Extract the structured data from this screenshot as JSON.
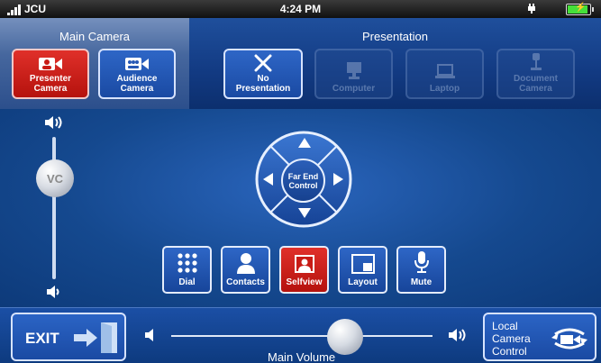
{
  "status_bar": {
    "carrier": "JCU",
    "time": "4:24 PM"
  },
  "camera_section": {
    "title": "Main Camera",
    "buttons": [
      {
        "label_line1": "Presenter",
        "label_line2": "Camera",
        "state": "selected"
      },
      {
        "label_line1": "Audience",
        "label_line2": "Camera",
        "state": "normal"
      }
    ]
  },
  "presentation_section": {
    "title": "Presentation",
    "buttons": [
      {
        "label_line1": "No",
        "label_line2": "Presentation",
        "state": "normal"
      },
      {
        "label_line1": "Computer",
        "label_line2": "",
        "state": "disabled"
      },
      {
        "label_line1": "Laptop",
        "label_line2": "",
        "state": "disabled"
      },
      {
        "label_line1": "Document",
        "label_line2": "Camera",
        "state": "disabled"
      }
    ]
  },
  "vc_volume": {
    "knob_label": "VC"
  },
  "far_end_control": {
    "line1": "Far End",
    "line2": "Control"
  },
  "function_buttons": [
    {
      "label": "Dial",
      "icon": "keypad-icon"
    },
    {
      "label": "Contacts",
      "icon": "person-icon"
    },
    {
      "label": "Selfview",
      "icon": "selfview-icon"
    },
    {
      "label": "Layout",
      "icon": "layout-icon"
    },
    {
      "label": "Mute",
      "icon": "microphone-icon"
    }
  ],
  "exit": {
    "label": "EXIT"
  },
  "main_volume": {
    "label": "Main Volume"
  },
  "local_camera": {
    "line1": "Local",
    "line2": "Camera",
    "line3": "Control"
  },
  "colors": {
    "accent_red": "#c81b15",
    "button_blue": "#2557b5",
    "background_blue": "#0d3a7a",
    "battery_green": "#45e03a"
  }
}
